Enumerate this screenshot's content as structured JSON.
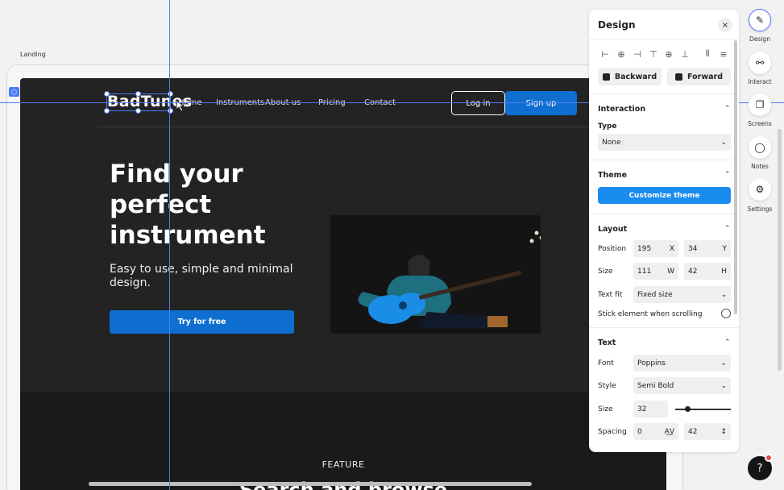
{
  "canvas": {
    "frame_label": "Landing",
    "logo": "BadTunes",
    "nav_links": [
      "Home",
      "Instruments",
      "About us",
      "Pricing",
      "Contact"
    ],
    "login": "Log in",
    "signup": "Sign up",
    "hero_title": "Find your perfect instrument",
    "hero_subtitle": "Easy to use, simple and minimal design.",
    "cta": "Try for free",
    "feature_label": "FEATURE",
    "section_title": "Search and browse",
    "colors": {
      "background": "#232323",
      "accent": "#0f6fd1",
      "guide": "#4c7cf3"
    }
  },
  "panel": {
    "title": "Design",
    "close": "×",
    "backward": "Backward",
    "forward": "Forward",
    "interaction": {
      "header": "Interaction",
      "type_label": "Type",
      "type_value": "None"
    },
    "theme": {
      "header": "Theme",
      "button": "Customize theme"
    },
    "layout": {
      "header": "Layout",
      "position_label": "Position",
      "x_value": "195",
      "x_unit": "X",
      "y_value": "34",
      "y_unit": "Y",
      "size_label": "Size",
      "w_value": "111",
      "w_unit": "W",
      "h_value": "42",
      "h_unit": "H",
      "textfit_label": "Text fit",
      "textfit_value": "Fixed size",
      "sticky_label": "Stick element when scrolling"
    },
    "text": {
      "header": "Text",
      "font_label": "Font",
      "font_value": "Poppins",
      "style_label": "Style",
      "style_value": "Semi Bold",
      "size_label": "Size",
      "size_value": "32",
      "spacing_label": "Spacing",
      "spacing_value": "0",
      "lineheight_value": "42"
    }
  },
  "rail": {
    "design": "Design",
    "interact": "Interact",
    "screens": "Screens",
    "notes": "Notes",
    "settings": "Settings",
    "help": "?"
  }
}
